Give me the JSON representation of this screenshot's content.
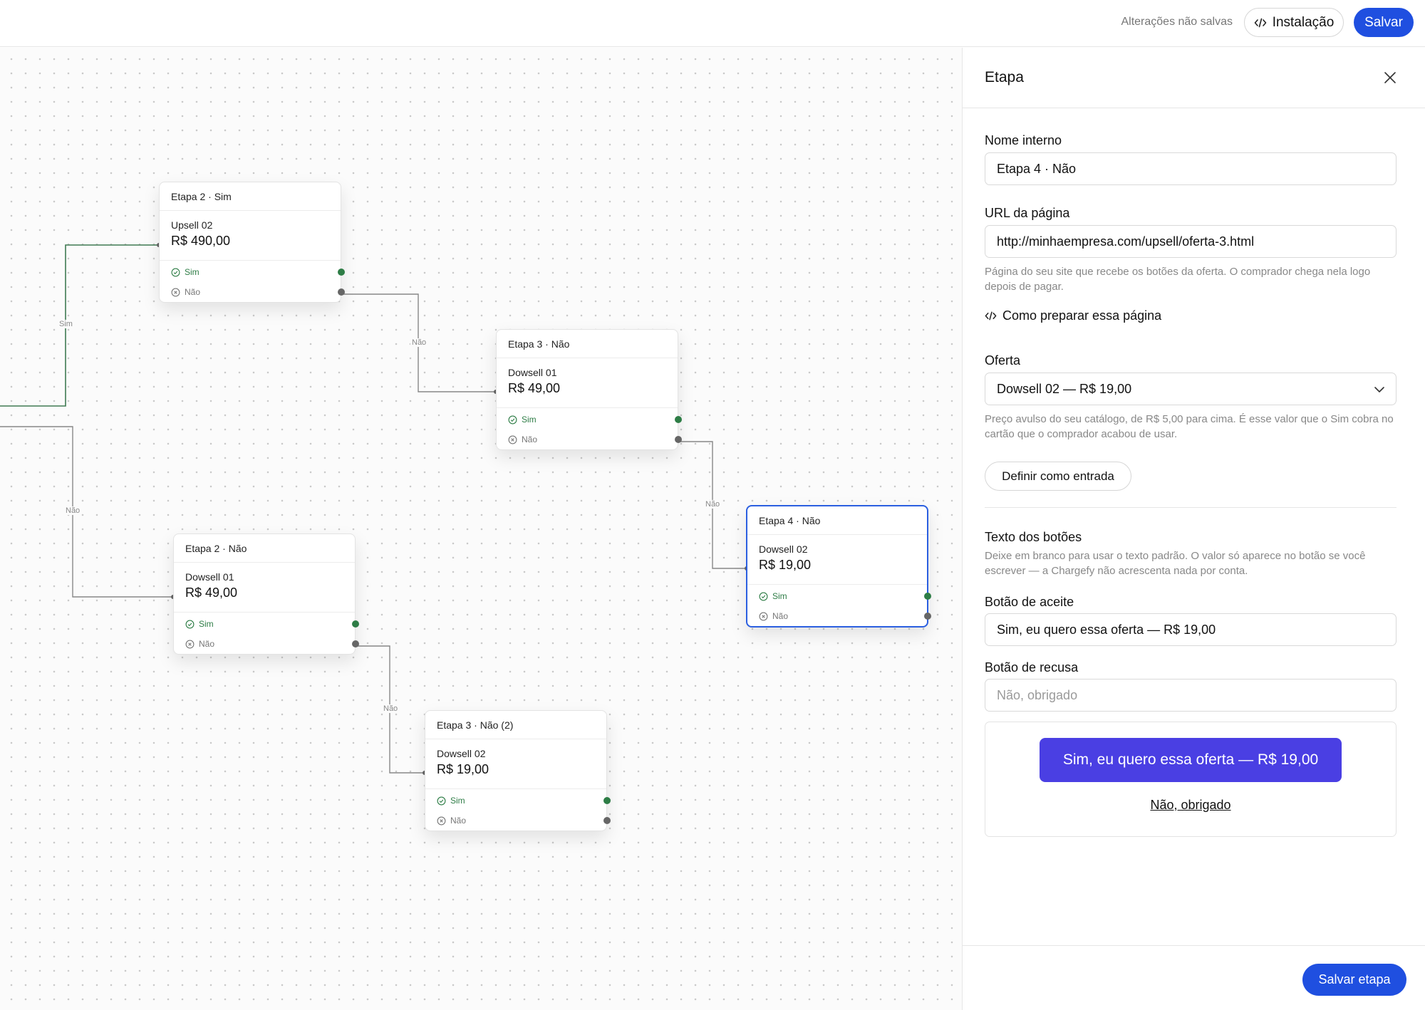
{
  "topbar": {
    "unsaved_text": "Alterações não salvas",
    "install_label": "Instalação",
    "save_label": "Salvar"
  },
  "canvas": {
    "nodes": [
      {
        "title": "Etapa 2 · Sim",
        "name": "Upsell 02",
        "price": "R$ 490,00",
        "yes": "Sim",
        "no": "Não"
      },
      {
        "title": "Etapa 3 · Não",
        "name": "Dowsell 01",
        "price": "R$ 49,00",
        "yes": "Sim",
        "no": "Não"
      },
      {
        "title": "Etapa 4 · Não",
        "name": "Dowsell 02",
        "price": "R$ 19,00",
        "yes": "Sim",
        "no": "Não"
      },
      {
        "title": "Etapa 2 · Não",
        "name": "Dowsell 01",
        "price": "R$ 49,00",
        "yes": "Sim",
        "no": "Não"
      },
      {
        "title": "Etapa 3 · Não (2)",
        "name": "Dowsell 02",
        "price": "R$ 19,00",
        "yes": "Sim",
        "no": "Não"
      }
    ],
    "wire_labels": [
      "Sim",
      "Não",
      "Não",
      "Não",
      "Não"
    ]
  },
  "panel": {
    "title": "Etapa",
    "internal_name_label": "Nome interno",
    "internal_name_value": "Etapa 4 · Não",
    "url_label": "URL da página",
    "url_value": "http://minhaempresa.com/upsell/oferta-3.html",
    "url_help": "Página do seu site que recebe os botões da oferta. O comprador chega nela logo depois de pagar.",
    "prepare_link": "Como preparar essa página",
    "offer_label": "Oferta",
    "offer_value": "Dowsell 02 — R$ 19,00",
    "offer_help": "Preço avulso do seu catálogo, de R$ 5,00 para cima. É esse valor que o Sim cobra no cartão que o comprador acabou de usar.",
    "set_entry_label": "Definir como entrada",
    "buttons_section_title": "Texto dos botões",
    "buttons_section_help": "Deixe em branco para usar o texto padrão. O valor só aparece no botão se você escrever — a Chargefy não acrescenta nada por conta.",
    "accept_label": "Botão de aceite",
    "accept_value": "Sim, eu quero essa oferta — R$ 19,00",
    "decline_label": "Botão de recusa",
    "decline_placeholder": "Não, obrigado",
    "preview_accept": "Sim, eu quero essa oferta — R$ 19,00",
    "preview_decline": "Não, obrigado",
    "save_step_label": "Salvar etapa"
  },
  "colors": {
    "primary": "#1f4fe0",
    "cta": "#4a3fe3",
    "yes_green": "#2e7d46",
    "selected_border": "#2b5fe0"
  }
}
